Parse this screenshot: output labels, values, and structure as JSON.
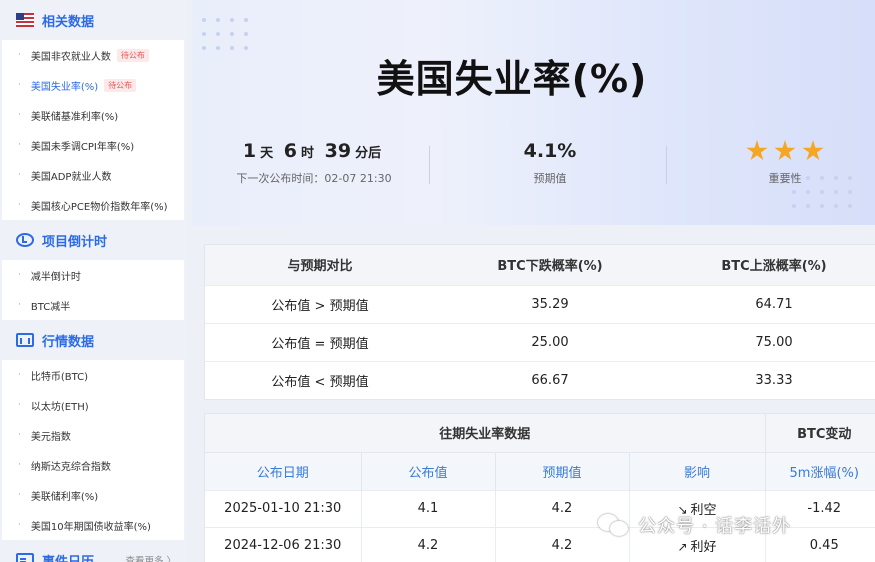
{
  "sidebar": {
    "sections": [
      {
        "title": "相关数据",
        "icon": "us-flag-icon",
        "items": [
          {
            "label": "美国非农就业人数",
            "badge": "待公布"
          },
          {
            "label": "美国失业率(%)",
            "badge": "待公布",
            "active": true
          },
          {
            "label": "美联储基准利率(%)"
          },
          {
            "label": "美国未季调CPI年率(%)"
          },
          {
            "label": "美国ADP就业人数"
          },
          {
            "label": "美国核心PCE物价指数年率(%)"
          }
        ]
      },
      {
        "title": "项目倒计时",
        "icon": "clock-icon",
        "items": [
          {
            "label": "减半倒计时"
          },
          {
            "label": "BTC减半"
          }
        ]
      },
      {
        "title": "行情数据",
        "icon": "chart-icon",
        "items": [
          {
            "label": "比特币(BTC)"
          },
          {
            "label": "以太坊(ETH)"
          },
          {
            "label": "美元指数"
          },
          {
            "label": "纳斯达克综合指数"
          },
          {
            "label": "美联储利率(%)"
          },
          {
            "label": "美国10年期国债收益率(%)"
          }
        ]
      },
      {
        "title": "事件日历",
        "icon": "calendar-icon",
        "more": "查看更多 〉",
        "items": []
      }
    ]
  },
  "hero": {
    "title": "美国失业率(%)",
    "countdown": {
      "d": "1",
      "d_unit": "天",
      "h": "6",
      "h_unit": "时",
      "m": "39",
      "m_unit": "分后"
    },
    "next_release": "下一次公布时间：02-07 21:30",
    "forecast_value": "4.1%",
    "forecast_label": "预期值",
    "importance_label": "重要性",
    "importance_stars": 3
  },
  "comparison": {
    "headers": [
      "与预期对比",
      "BTC下跌概率(%)",
      "BTC上涨概率(%)"
    ],
    "rows": [
      [
        "公布值 > 预期值",
        "35.29",
        "64.71"
      ],
      [
        "公布值 = 预期值",
        "25.00",
        "75.00"
      ],
      [
        "公布值 < 预期值",
        "66.67",
        "33.33"
      ]
    ]
  },
  "history": {
    "group_header": "往期失业率数据",
    "btc_header": "BTC变动",
    "columns": [
      "公布日期",
      "公布值",
      "预期值",
      "影响",
      "5m涨幅(%)"
    ],
    "rows": [
      {
        "date": "2025-01-10 21:30",
        "actual": "4.1",
        "forecast": "4.2",
        "impact": "利空",
        "impact_type": "bearish",
        "change": "-1.42"
      },
      {
        "date": "2024-12-06 21:30",
        "actual": "4.2",
        "forecast": "4.2",
        "impact": "利好",
        "impact_type": "bullish",
        "change": "0.45"
      }
    ]
  },
  "watermark": {
    "text": "公众号 · 话李话外"
  },
  "colors": {
    "accent": "#2d6be4",
    "negative": "#e03c3c",
    "positive": "#2fae5b",
    "star": "#f5a623"
  }
}
